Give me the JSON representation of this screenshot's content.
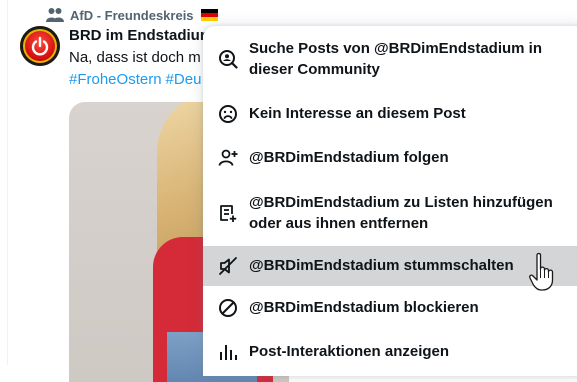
{
  "community": {
    "name": "AfD - Freundeskreis",
    "flag_colors": [
      "#000000",
      "#dd0000",
      "#ffce00"
    ]
  },
  "tweet": {
    "author": "BRD im Endstadiur",
    "text": "Na, dass ist doch m",
    "hashtags": [
      "#FroheOstern",
      "#Deu"
    ]
  },
  "menu": {
    "items": [
      {
        "label": "Suche Posts von @BRDimEndstadium in dieser Community",
        "icon": "search-community-icon"
      },
      {
        "label": "Kein Interesse an diesem Post",
        "icon": "sad-face-icon"
      },
      {
        "label": "@BRDimEndstadium folgen",
        "icon": "follow-user-icon"
      },
      {
        "label": "@BRDimEndstadium zu Listen hinzufügen oder aus ihnen entfernen",
        "icon": "list-add-icon"
      },
      {
        "label": "@BRDimEndstadium stummschalten",
        "icon": "mute-icon"
      },
      {
        "label": "@BRDimEndstadium blockieren",
        "icon": "block-icon"
      },
      {
        "label": "Post-Interaktionen anzeigen",
        "icon": "analytics-icon"
      }
    ],
    "hovered_index": 4
  },
  "colors": {
    "accent": "#1d9bf0",
    "text": "#0f1419",
    "secondary_text": "#536471",
    "hover_background": "#d4d5d6"
  }
}
